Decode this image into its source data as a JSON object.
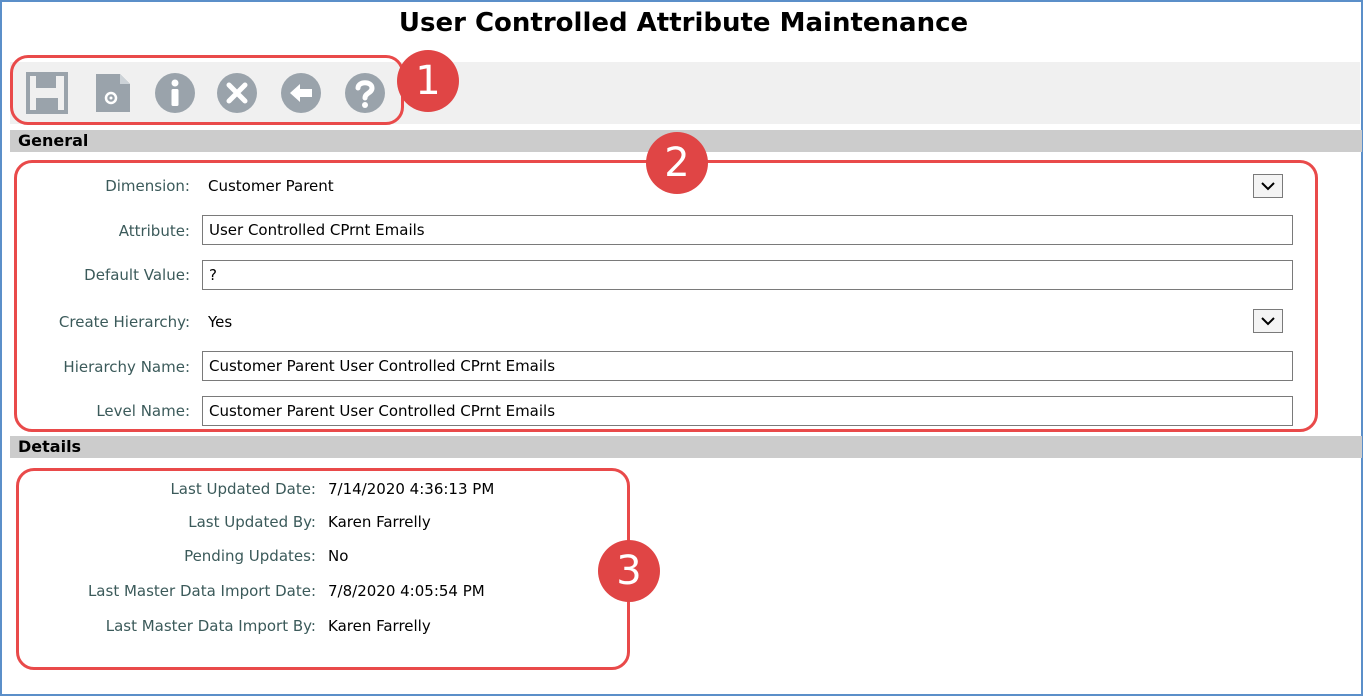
{
  "title": "User Controlled Attribute Maintenance",
  "toolbar": {
    "icons": [
      "save-icon",
      "settings-document-icon",
      "info-icon",
      "cancel-icon",
      "back-icon",
      "help-icon"
    ]
  },
  "general": {
    "section_title": "General",
    "dimension": {
      "label": "Dimension:",
      "value": "Customer Parent"
    },
    "attribute": {
      "label": "Attribute:",
      "value": "User Controlled CPrnt Emails"
    },
    "default_value": {
      "label": "Default Value:",
      "value": "?"
    },
    "create_hierarchy": {
      "label": "Create Hierarchy:",
      "value": "Yes"
    },
    "hierarchy_name": {
      "label": "Hierarchy Name:",
      "value": "Customer Parent User Controlled CPrnt Emails"
    },
    "level_name": {
      "label": "Level Name:",
      "value": "Customer Parent User Controlled CPrnt Emails"
    }
  },
  "details": {
    "section_title": "Details",
    "rows": [
      {
        "label": "Last Updated Date:",
        "value": "7/14/2020 4:36:13 PM"
      },
      {
        "label": "Last Updated By:",
        "value": "Karen Farrelly"
      },
      {
        "label": "Pending Updates:",
        "value": "No"
      },
      {
        "label": "Last Master Data Import Date:",
        "value": "7/8/2020 4:05:54 PM"
      },
      {
        "label": "Last Master Data Import By:",
        "value": "Karen Farrelly"
      }
    ]
  },
  "callouts": [
    "1",
    "2",
    "3"
  ],
  "colors": {
    "callout": "#e94a4a",
    "badge": "#e04545",
    "icon": "#9aa3ab",
    "frame": "#5b8fc9"
  }
}
